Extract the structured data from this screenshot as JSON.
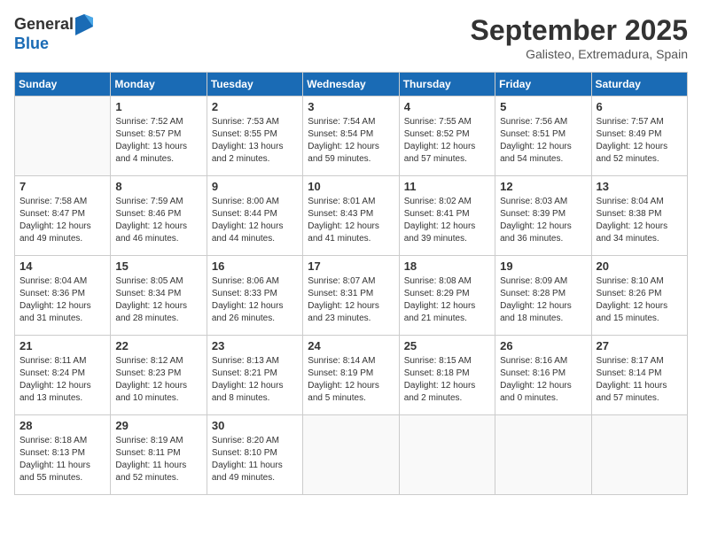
{
  "logo": {
    "general": "General",
    "blue": "Blue"
  },
  "title": "September 2025",
  "location": "Galisteo, Extremadura, Spain",
  "days_of_week": [
    "Sunday",
    "Monday",
    "Tuesday",
    "Wednesday",
    "Thursday",
    "Friday",
    "Saturday"
  ],
  "weeks": [
    [
      {
        "day": "",
        "sunrise": "",
        "sunset": "",
        "daylight": ""
      },
      {
        "day": "1",
        "sunrise": "Sunrise: 7:52 AM",
        "sunset": "Sunset: 8:57 PM",
        "daylight": "Daylight: 13 hours and 4 minutes."
      },
      {
        "day": "2",
        "sunrise": "Sunrise: 7:53 AM",
        "sunset": "Sunset: 8:55 PM",
        "daylight": "Daylight: 13 hours and 2 minutes."
      },
      {
        "day": "3",
        "sunrise": "Sunrise: 7:54 AM",
        "sunset": "Sunset: 8:54 PM",
        "daylight": "Daylight: 12 hours and 59 minutes."
      },
      {
        "day": "4",
        "sunrise": "Sunrise: 7:55 AM",
        "sunset": "Sunset: 8:52 PM",
        "daylight": "Daylight: 12 hours and 57 minutes."
      },
      {
        "day": "5",
        "sunrise": "Sunrise: 7:56 AM",
        "sunset": "Sunset: 8:51 PM",
        "daylight": "Daylight: 12 hours and 54 minutes."
      },
      {
        "day": "6",
        "sunrise": "Sunrise: 7:57 AM",
        "sunset": "Sunset: 8:49 PM",
        "daylight": "Daylight: 12 hours and 52 minutes."
      }
    ],
    [
      {
        "day": "7",
        "sunrise": "Sunrise: 7:58 AM",
        "sunset": "Sunset: 8:47 PM",
        "daylight": "Daylight: 12 hours and 49 minutes."
      },
      {
        "day": "8",
        "sunrise": "Sunrise: 7:59 AM",
        "sunset": "Sunset: 8:46 PM",
        "daylight": "Daylight: 12 hours and 46 minutes."
      },
      {
        "day": "9",
        "sunrise": "Sunrise: 8:00 AM",
        "sunset": "Sunset: 8:44 PM",
        "daylight": "Daylight: 12 hours and 44 minutes."
      },
      {
        "day": "10",
        "sunrise": "Sunrise: 8:01 AM",
        "sunset": "Sunset: 8:43 PM",
        "daylight": "Daylight: 12 hours and 41 minutes."
      },
      {
        "day": "11",
        "sunrise": "Sunrise: 8:02 AM",
        "sunset": "Sunset: 8:41 PM",
        "daylight": "Daylight: 12 hours and 39 minutes."
      },
      {
        "day": "12",
        "sunrise": "Sunrise: 8:03 AM",
        "sunset": "Sunset: 8:39 PM",
        "daylight": "Daylight: 12 hours and 36 minutes."
      },
      {
        "day": "13",
        "sunrise": "Sunrise: 8:04 AM",
        "sunset": "Sunset: 8:38 PM",
        "daylight": "Daylight: 12 hours and 34 minutes."
      }
    ],
    [
      {
        "day": "14",
        "sunrise": "Sunrise: 8:04 AM",
        "sunset": "Sunset: 8:36 PM",
        "daylight": "Daylight: 12 hours and 31 minutes."
      },
      {
        "day": "15",
        "sunrise": "Sunrise: 8:05 AM",
        "sunset": "Sunset: 8:34 PM",
        "daylight": "Daylight: 12 hours and 28 minutes."
      },
      {
        "day": "16",
        "sunrise": "Sunrise: 8:06 AM",
        "sunset": "Sunset: 8:33 PM",
        "daylight": "Daylight: 12 hours and 26 minutes."
      },
      {
        "day": "17",
        "sunrise": "Sunrise: 8:07 AM",
        "sunset": "Sunset: 8:31 PM",
        "daylight": "Daylight: 12 hours and 23 minutes."
      },
      {
        "day": "18",
        "sunrise": "Sunrise: 8:08 AM",
        "sunset": "Sunset: 8:29 PM",
        "daylight": "Daylight: 12 hours and 21 minutes."
      },
      {
        "day": "19",
        "sunrise": "Sunrise: 8:09 AM",
        "sunset": "Sunset: 8:28 PM",
        "daylight": "Daylight: 12 hours and 18 minutes."
      },
      {
        "day": "20",
        "sunrise": "Sunrise: 8:10 AM",
        "sunset": "Sunset: 8:26 PM",
        "daylight": "Daylight: 12 hours and 15 minutes."
      }
    ],
    [
      {
        "day": "21",
        "sunrise": "Sunrise: 8:11 AM",
        "sunset": "Sunset: 8:24 PM",
        "daylight": "Daylight: 12 hours and 13 minutes."
      },
      {
        "day": "22",
        "sunrise": "Sunrise: 8:12 AM",
        "sunset": "Sunset: 8:23 PM",
        "daylight": "Daylight: 12 hours and 10 minutes."
      },
      {
        "day": "23",
        "sunrise": "Sunrise: 8:13 AM",
        "sunset": "Sunset: 8:21 PM",
        "daylight": "Daylight: 12 hours and 8 minutes."
      },
      {
        "day": "24",
        "sunrise": "Sunrise: 8:14 AM",
        "sunset": "Sunset: 8:19 PM",
        "daylight": "Daylight: 12 hours and 5 minutes."
      },
      {
        "day": "25",
        "sunrise": "Sunrise: 8:15 AM",
        "sunset": "Sunset: 8:18 PM",
        "daylight": "Daylight: 12 hours and 2 minutes."
      },
      {
        "day": "26",
        "sunrise": "Sunrise: 8:16 AM",
        "sunset": "Sunset: 8:16 PM",
        "daylight": "Daylight: 12 hours and 0 minutes."
      },
      {
        "day": "27",
        "sunrise": "Sunrise: 8:17 AM",
        "sunset": "Sunset: 8:14 PM",
        "daylight": "Daylight: 11 hours and 57 minutes."
      }
    ],
    [
      {
        "day": "28",
        "sunrise": "Sunrise: 8:18 AM",
        "sunset": "Sunset: 8:13 PM",
        "daylight": "Daylight: 11 hours and 55 minutes."
      },
      {
        "day": "29",
        "sunrise": "Sunrise: 8:19 AM",
        "sunset": "Sunset: 8:11 PM",
        "daylight": "Daylight: 11 hours and 52 minutes."
      },
      {
        "day": "30",
        "sunrise": "Sunrise: 8:20 AM",
        "sunset": "Sunset: 8:10 PM",
        "daylight": "Daylight: 11 hours and 49 minutes."
      },
      {
        "day": "",
        "sunrise": "",
        "sunset": "",
        "daylight": ""
      },
      {
        "day": "",
        "sunrise": "",
        "sunset": "",
        "daylight": ""
      },
      {
        "day": "",
        "sunrise": "",
        "sunset": "",
        "daylight": ""
      },
      {
        "day": "",
        "sunrise": "",
        "sunset": "",
        "daylight": ""
      }
    ]
  ]
}
